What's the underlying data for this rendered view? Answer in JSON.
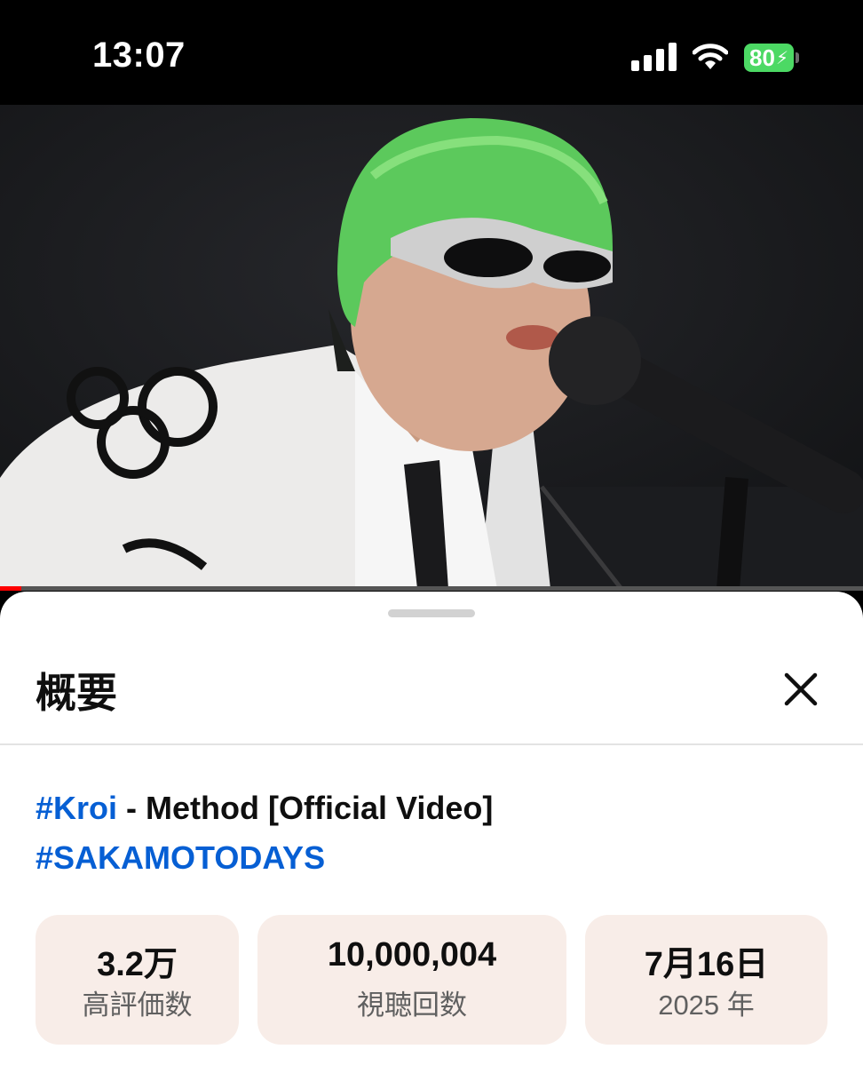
{
  "status_bar": {
    "time": "13:07",
    "battery": "80"
  },
  "video": {
    "progress_fraction": 0.025
  },
  "sheet": {
    "title": "概要",
    "video_title": {
      "hashtag_1": "#Kroi",
      "text": " - Method [Official Video] ",
      "hashtag_2": "#SAKAMOTODAYS"
    },
    "stats": [
      {
        "value": "3.2万",
        "label": "高評価数"
      },
      {
        "value": "10,000,004",
        "label": "視聴回数"
      },
      {
        "value": "7月16日",
        "label": "2025 年"
      }
    ]
  },
  "colors": {
    "link": "#065fd4",
    "stat_bg": "#f8ede8",
    "progress": "#ff0000",
    "battery": "#4cd964"
  },
  "icons": [
    "signal-icon",
    "wifi-icon",
    "battery-icon",
    "close-icon"
  ]
}
